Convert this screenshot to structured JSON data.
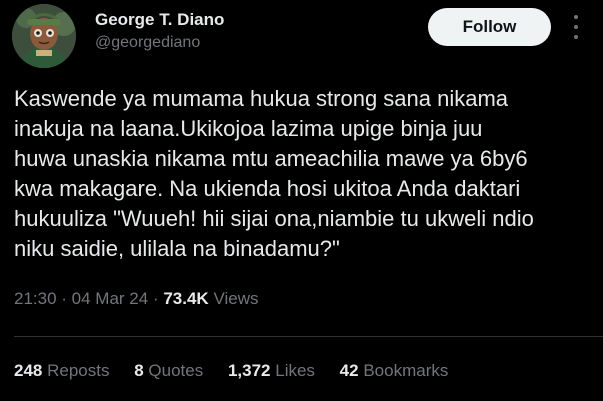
{
  "author": {
    "name": "George T. Diano",
    "handle": "@georgediano"
  },
  "follow_button": {
    "label": "Follow"
  },
  "more_icon": "more-vertical-icon",
  "tweet": {
    "lines": [
      "Kaswende ya mumama hukua strong sana nikama",
      "inakuja na laana.Ukikojoa lazima upige binja juu",
      "huwa unaskia nikama mtu ameachilia mawe ya 6by6",
      "kwa makagare. Na ukienda hosi ukitoa Anda daktari",
      "hukuuliza \"Wuueh! hii sijai ona,niambie tu ukweli ndio",
      "niku saidie, ulilala na binadamu?\""
    ]
  },
  "meta": {
    "time": "21:30",
    "date": "04 Mar 24",
    "views_count": "73.4K",
    "views_label": "Views"
  },
  "stats": {
    "reposts": {
      "count": "248",
      "label": "Reposts"
    },
    "quotes": {
      "count": "8",
      "label": "Quotes"
    },
    "likes": {
      "count": "1,372",
      "label": "Likes"
    },
    "bookmarks": {
      "count": "42",
      "label": "Bookmarks"
    }
  },
  "colors": {
    "background": "#000000",
    "primary_text": "#e7e9ea",
    "secondary_text": "#71767b",
    "button_bg": "#eff3f4",
    "divider": "#2f3336"
  }
}
